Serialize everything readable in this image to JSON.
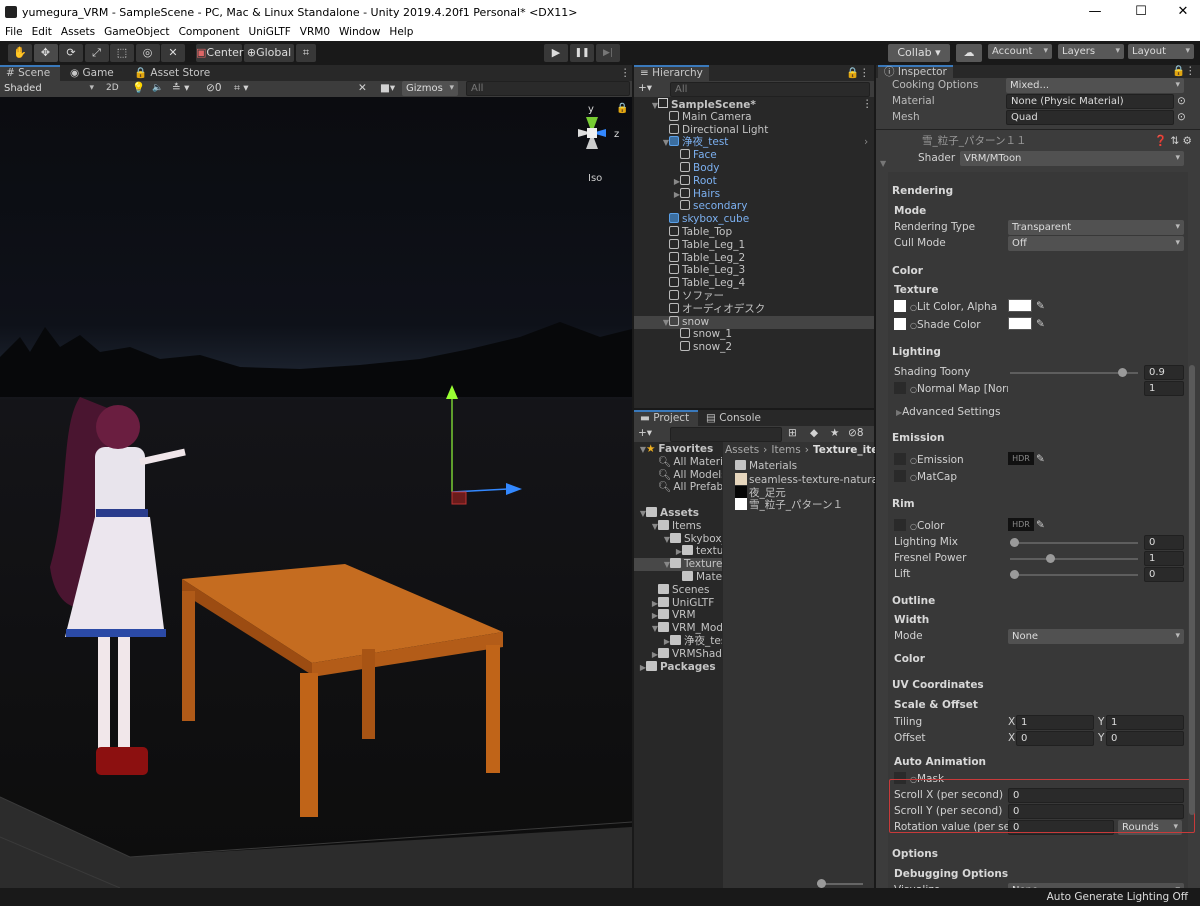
{
  "window": {
    "title": "yumegura_VRM - SampleScene - PC, Mac & Linux Standalone - Unity 2019.4.20f1 Personal* <DX11>",
    "minimize": "—",
    "maximize": "☐",
    "close": "✕"
  },
  "menu": [
    "File",
    "Edit",
    "Assets",
    "GameObject",
    "Component",
    "UniGLTF",
    "VRM0",
    "Window",
    "Help"
  ],
  "toolbar": {
    "tools": [
      "✋",
      "✥",
      "⟳",
      "⤢",
      "⬚",
      "◎",
      "✕"
    ],
    "pivot": "Center",
    "space": "Global",
    "play": "▶",
    "pause": "❚❚",
    "step": "▶|",
    "collab": "Collab ▾",
    "cloud": "☁",
    "account": "Account",
    "layers": "Layers",
    "layout": "Layout"
  },
  "scene": {
    "tabs": [
      "Scene",
      "Game",
      "Asset Store"
    ],
    "shading": "Shaded",
    "mode2d": "2D",
    "hidden_count": "0",
    "gizmos": "Gizmos",
    "search_placeholder": "All",
    "projection": "Iso",
    "axis_y": "y",
    "axis_z": "z"
  },
  "hierarchy": {
    "tab": "Hierarchy",
    "search_placeholder": "All",
    "items": [
      {
        "label": "SampleScene*",
        "depth": 0,
        "icon": "scene",
        "expanded": true,
        "bold": true
      },
      {
        "label": "Main Camera",
        "depth": 1,
        "icon": "cube"
      },
      {
        "label": "Directional Light",
        "depth": 1,
        "icon": "cube"
      },
      {
        "label": "浄夜_test",
        "depth": 1,
        "icon": "prefab",
        "expanded": true,
        "blue": true
      },
      {
        "label": "Face",
        "depth": 2,
        "icon": "cube",
        "blue": true
      },
      {
        "label": "Body",
        "depth": 2,
        "icon": "cube",
        "blue": true
      },
      {
        "label": "Root",
        "depth": 2,
        "icon": "cube",
        "blue": true,
        "collapsed": true
      },
      {
        "label": "Hairs",
        "depth": 2,
        "icon": "cube",
        "blue": true,
        "collapsed": true
      },
      {
        "label": "secondary",
        "depth": 2,
        "icon": "cube",
        "blue": true
      },
      {
        "label": "skybox_cube",
        "depth": 1,
        "icon": "prefab",
        "blue": true
      },
      {
        "label": "Table_Top",
        "depth": 1,
        "icon": "cube"
      },
      {
        "label": "Table_Leg_1",
        "depth": 1,
        "icon": "cube"
      },
      {
        "label": "Table_Leg_2",
        "depth": 1,
        "icon": "cube"
      },
      {
        "label": "Table_Leg_3",
        "depth": 1,
        "icon": "cube"
      },
      {
        "label": "Table_Leg_4",
        "depth": 1,
        "icon": "cube"
      },
      {
        "label": "ソファー",
        "depth": 1,
        "icon": "cube"
      },
      {
        "label": "オーディオデスク",
        "depth": 1,
        "icon": "cube"
      },
      {
        "label": "snow",
        "depth": 1,
        "icon": "cube",
        "expanded": true,
        "selected": true
      },
      {
        "label": "snow_1",
        "depth": 2,
        "icon": "cube"
      },
      {
        "label": "snow_2",
        "depth": 2,
        "icon": "cube"
      }
    ]
  },
  "project": {
    "tabs": [
      "Project",
      "Console"
    ],
    "hidden_count": "8",
    "breadcrumb": [
      "Assets",
      "Items",
      "Texture_item"
    ],
    "tree": [
      {
        "label": "Favorites",
        "depth": 0,
        "bold": true,
        "icon": "star",
        "expanded": true
      },
      {
        "label": "All Materia",
        "depth": 1,
        "icon": "search"
      },
      {
        "label": "All Models",
        "depth": 1,
        "icon": "search"
      },
      {
        "label": "All Prefabs",
        "depth": 1,
        "icon": "search"
      },
      {
        "label": "",
        "depth": 0,
        "icon": "none"
      },
      {
        "label": "Assets",
        "depth": 0,
        "bold": true,
        "icon": "folder",
        "expanded": true
      },
      {
        "label": "Items",
        "depth": 1,
        "icon": "folder",
        "expanded": true
      },
      {
        "label": "Skybox_",
        "depth": 2,
        "icon": "folder",
        "expanded": true
      },
      {
        "label": "textur",
        "depth": 3,
        "icon": "folder",
        "collapsed": true
      },
      {
        "label": "Texture_",
        "depth": 2,
        "icon": "folder",
        "expanded": true,
        "selected": true
      },
      {
        "label": "Mater",
        "depth": 3,
        "icon": "folder"
      },
      {
        "label": "Scenes",
        "depth": 1,
        "icon": "folder"
      },
      {
        "label": "UniGLTF",
        "depth": 1,
        "icon": "folder",
        "collapsed": true
      },
      {
        "label": "VRM",
        "depth": 1,
        "icon": "folder",
        "collapsed": true
      },
      {
        "label": "VRM_Mode",
        "depth": 1,
        "icon": "folder",
        "expanded": true
      },
      {
        "label": "浄夜_tes",
        "depth": 2,
        "icon": "folder",
        "collapsed": true
      },
      {
        "label": "VRMShade",
        "depth": 1,
        "icon": "folder",
        "collapsed": true
      },
      {
        "label": "Packages",
        "depth": 0,
        "bold": true,
        "icon": "folder",
        "collapsed": true
      }
    ],
    "files": [
      {
        "label": "Materials",
        "swatch": "folder"
      },
      {
        "label": "seamless-texture-natural-",
        "swatch": "#e6d6bd"
      },
      {
        "label": "夜_足元",
        "swatch": "#050505"
      },
      {
        "label": "雪_粒子_パターン１",
        "swatch": "#ffffff"
      }
    ]
  },
  "inspector": {
    "tab": "Inspector",
    "material_name": "雪_粒子_パターン１１",
    "shader_label": "Shader",
    "shader": "VRM/MToon",
    "top_rows": [
      {
        "label": "Cooking Options",
        "value": "Mixed...",
        "kind": "dropdown"
      },
      {
        "label": "Material",
        "value": "None (Physic Material)",
        "kind": "object"
      },
      {
        "label": "Mesh",
        "value": "Quad",
        "kind": "object"
      }
    ],
    "rows": [
      {
        "kind": "section",
        "label": "Rendering"
      },
      {
        "kind": "sub",
        "label": "Mode"
      },
      {
        "kind": "dropdown",
        "label": "Rendering Type",
        "value": "Transparent"
      },
      {
        "kind": "dropdown",
        "label": "Cull Mode",
        "value": "Off"
      },
      {
        "kind": "section",
        "label": "Color"
      },
      {
        "kind": "sub",
        "label": "Texture"
      },
      {
        "kind": "color",
        "label": "Lit Color, Alpha",
        "color": "#ffffff"
      },
      {
        "kind": "color",
        "label": "Shade Color",
        "color": "#ffffff"
      },
      {
        "kind": "section",
        "label": "Lighting"
      },
      {
        "kind": "slider",
        "label": "Shading Toony",
        "value": "0.9",
        "fraction": 0.9
      },
      {
        "kind": "texnum",
        "label": "Normal Map [Norma",
        "value": "1"
      },
      {
        "kind": "fold",
        "label": "Advanced Settings"
      },
      {
        "kind": "section",
        "label": "Emission"
      },
      {
        "kind": "hdr",
        "label": "Emission",
        "hdr": "HDR"
      },
      {
        "kind": "tex",
        "label": "MatCap"
      },
      {
        "kind": "section",
        "label": "Rim"
      },
      {
        "kind": "hdr",
        "label": "Color",
        "hdr": "HDR"
      },
      {
        "kind": "slider",
        "label": "Lighting Mix",
        "value": "0",
        "fraction": 0
      },
      {
        "kind": "slider",
        "label": "Fresnel Power",
        "value": "1",
        "fraction": 0.3
      },
      {
        "kind": "slider",
        "label": "Lift",
        "value": "0",
        "fraction": 0
      },
      {
        "kind": "section",
        "label": "Outline"
      },
      {
        "kind": "sub",
        "label": "Width"
      },
      {
        "kind": "dropdown",
        "label": "Mode",
        "value": "None"
      },
      {
        "kind": "sub",
        "label": "Color"
      },
      {
        "kind": "section",
        "label": "UV Coordinates"
      },
      {
        "kind": "sub",
        "label": "Scale & Offset"
      },
      {
        "kind": "xy",
        "label": "Tiling",
        "x": "1",
        "y": "1"
      },
      {
        "kind": "xy",
        "label": "Offset",
        "x": "0",
        "y": "0"
      },
      {
        "kind": "sub",
        "label": "Auto Animation"
      },
      {
        "kind": "tex",
        "label": "Mask"
      },
      {
        "kind": "num",
        "label": "Scroll X (per second)",
        "value": "0"
      },
      {
        "kind": "num",
        "label": "Scroll Y (per second)",
        "value": "0"
      },
      {
        "kind": "numdd",
        "label": "Rotation value (per seco",
        "value": "0",
        "option": "Rounds"
      },
      {
        "kind": "section",
        "label": "Options"
      },
      {
        "kind": "sub",
        "label": "Debugging Options"
      },
      {
        "kind": "dropdown",
        "label": "Visualize",
        "value": "None"
      }
    ],
    "highlight_color": "#c83a3a"
  },
  "status": {
    "text": "Auto Generate Lighting Off"
  }
}
